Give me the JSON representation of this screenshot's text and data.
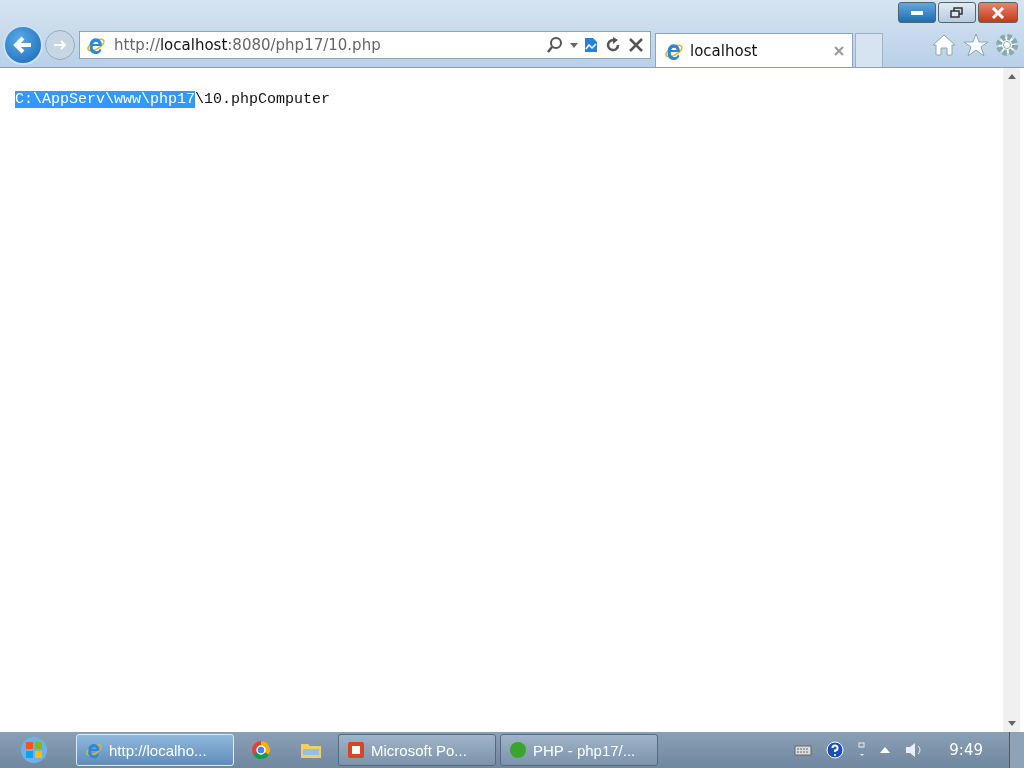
{
  "address_bar": {
    "url": "http://**localhost**:8080/php17/10.php"
  },
  "tabs": [
    {
      "label": "localhost",
      "selected": true
    }
  ],
  "page": {
    "segments": [
      {
        "text": "C:\\AppServ\\www\\php17",
        "selected": true
      },
      {
        "text": "\\10.phpComputer",
        "selected": false
      }
    ]
  },
  "taskbar": {
    "items": [
      {
        "kind": "browser",
        "label": "http://localho...",
        "selected": true
      },
      {
        "kind": "chrome",
        "selected": false
      },
      {
        "kind": "folder",
        "selected": false
      },
      {
        "kind": "presentation",
        "label": "Microsoft Po...",
        "selected": false
      },
      {
        "kind": "app",
        "label": "PHP - php17/...",
        "selected": false
      }
    ],
    "clock": "9:49"
  }
}
